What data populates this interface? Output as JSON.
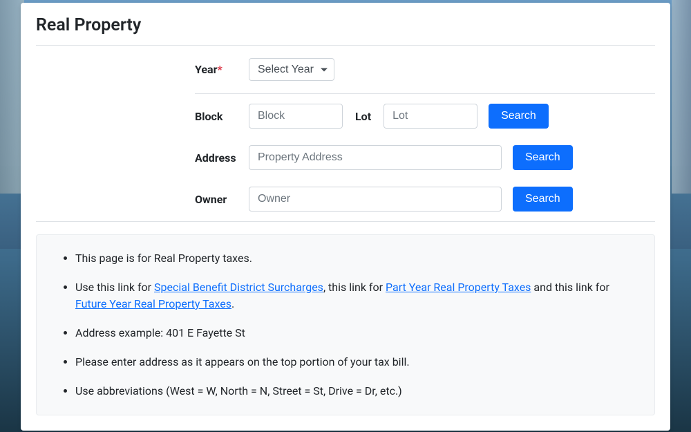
{
  "title": "Real Property",
  "form": {
    "year_label": "Year",
    "year_placeholder": "Select Year",
    "block_label": "Block",
    "block_placeholder": "Block",
    "lot_label": "Lot",
    "lot_placeholder": "Lot",
    "address_label": "Address",
    "address_placeholder": "Property Address",
    "owner_label": "Owner",
    "owner_placeholder": "Owner",
    "search_label": "Search"
  },
  "info": {
    "li1": "This page is for Real Property taxes.",
    "li2_pre": "Use this link for ",
    "link1": "Special Benefit District Surcharges",
    "li2_mid1": ", this link for ",
    "link2": "Part Year Real Property Taxes",
    "li2_mid2": " and this link for ",
    "link3": "Future Year Real Property Taxes",
    "li2_post": ".",
    "li3": "Address example: 401 E Fayette St",
    "li4": "Please enter address as it appears on the top portion of your tax bill.",
    "li5": "Use abbreviations (West = W, North = N, Street = St, Drive = Dr, etc.)"
  }
}
